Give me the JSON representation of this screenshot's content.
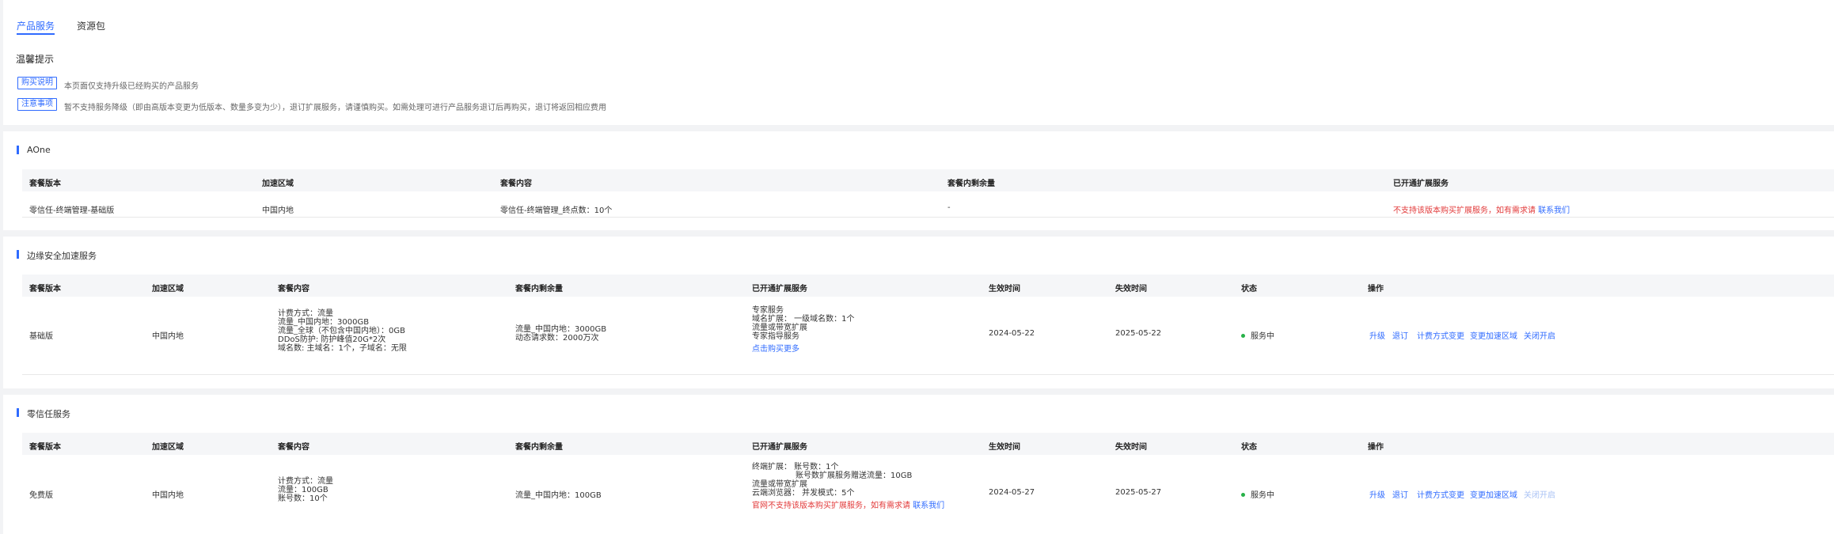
{
  "tabs": [
    {
      "label": "产品服务"
    },
    {
      "label": "资源包"
    }
  ],
  "tips": {
    "title": "温馨提示",
    "items": [
      {
        "tag": "购买说明",
        "text": "本页面仅支持升级已经购买的产品服务"
      },
      {
        "tag": "注意事项",
        "text": "暂不支持服务降级（即由高版本变更为低版本、数量多变为少），退订扩展服务，请谨慎购买。如需处理可进行产品服务退订后再购买，退订将返回相应费用"
      }
    ]
  },
  "aone": {
    "title": "AOne",
    "headers": [
      "套餐版本",
      "加速区域",
      "套餐内容",
      "套餐内剩余量",
      "已开通扩展服务"
    ],
    "row": {
      "version": "零信任-终端管理-基础版",
      "region": "中国内地",
      "content": "零信任-终端管理_终点数：10个",
      "remaining": "-",
      "ext_red": "不支持该版本购买扩展服务，如有需求请",
      "ext_link": "联系我们"
    }
  },
  "edge": {
    "title": "边缘安全加速服务",
    "headers": [
      "套餐版本",
      "加速区域",
      "套餐内容",
      "套餐内剩余量",
      "已开通扩展服务",
      "生效时间",
      "失效时间",
      "状态",
      "操作"
    ],
    "row": {
      "version": "基础版",
      "region": "中国内地",
      "content": [
        "计费方式：流量",
        "流量_中国内地：3000GB",
        "流量_全球（不包含中国内地）：0GB",
        "DDoS防护: 防护峰值20G*2次",
        "域名数: 主域名：1个，子域名：无限"
      ],
      "remaining": [
        "流量_中国内地：3000GB",
        "动态请求数：2000万次"
      ],
      "ext": [
        "专家服务",
        "域名扩展：  一级域名数：1个",
        "流量或带宽扩展",
        "专家指导服务"
      ],
      "ext_link": "点击购买更多",
      "start": "2024-05-22",
      "end": "2025-05-22",
      "status": "服务中",
      "actions": [
        "升级",
        "退订",
        "计费方式变更",
        "变更加速区域",
        "关闭开启"
      ]
    }
  },
  "zero": {
    "title": "零信任服务",
    "headers": [
      "套餐版本",
      "加速区域",
      "套餐内容",
      "套餐内剩余量",
      "已开通扩展服务",
      "生效时间",
      "失效时间",
      "状态",
      "操作"
    ],
    "row": {
      "version": "免费版",
      "region": "中国内地",
      "content": [
        "计费方式：流量",
        "流量：100GB",
        "账号数：10个"
      ],
      "remaining": "流量_中国内地：100GB",
      "ext": [
        "终端扩展：  账号数：1个",
        "账号数扩展服务赠送流量：10GB",
        "流量或带宽扩展",
        "云端浏览器：  并发模式：5个"
      ],
      "ext_red": "官网不支持该版本购买扩展服务，如有需求请",
      "ext_link": "联系我们",
      "start": "2024-05-27",
      "end": "2025-05-27",
      "status": "服务中",
      "actions": [
        "升级",
        "退订",
        "计费方式变更",
        "变更加速区域",
        "关闭开启"
      ]
    }
  }
}
